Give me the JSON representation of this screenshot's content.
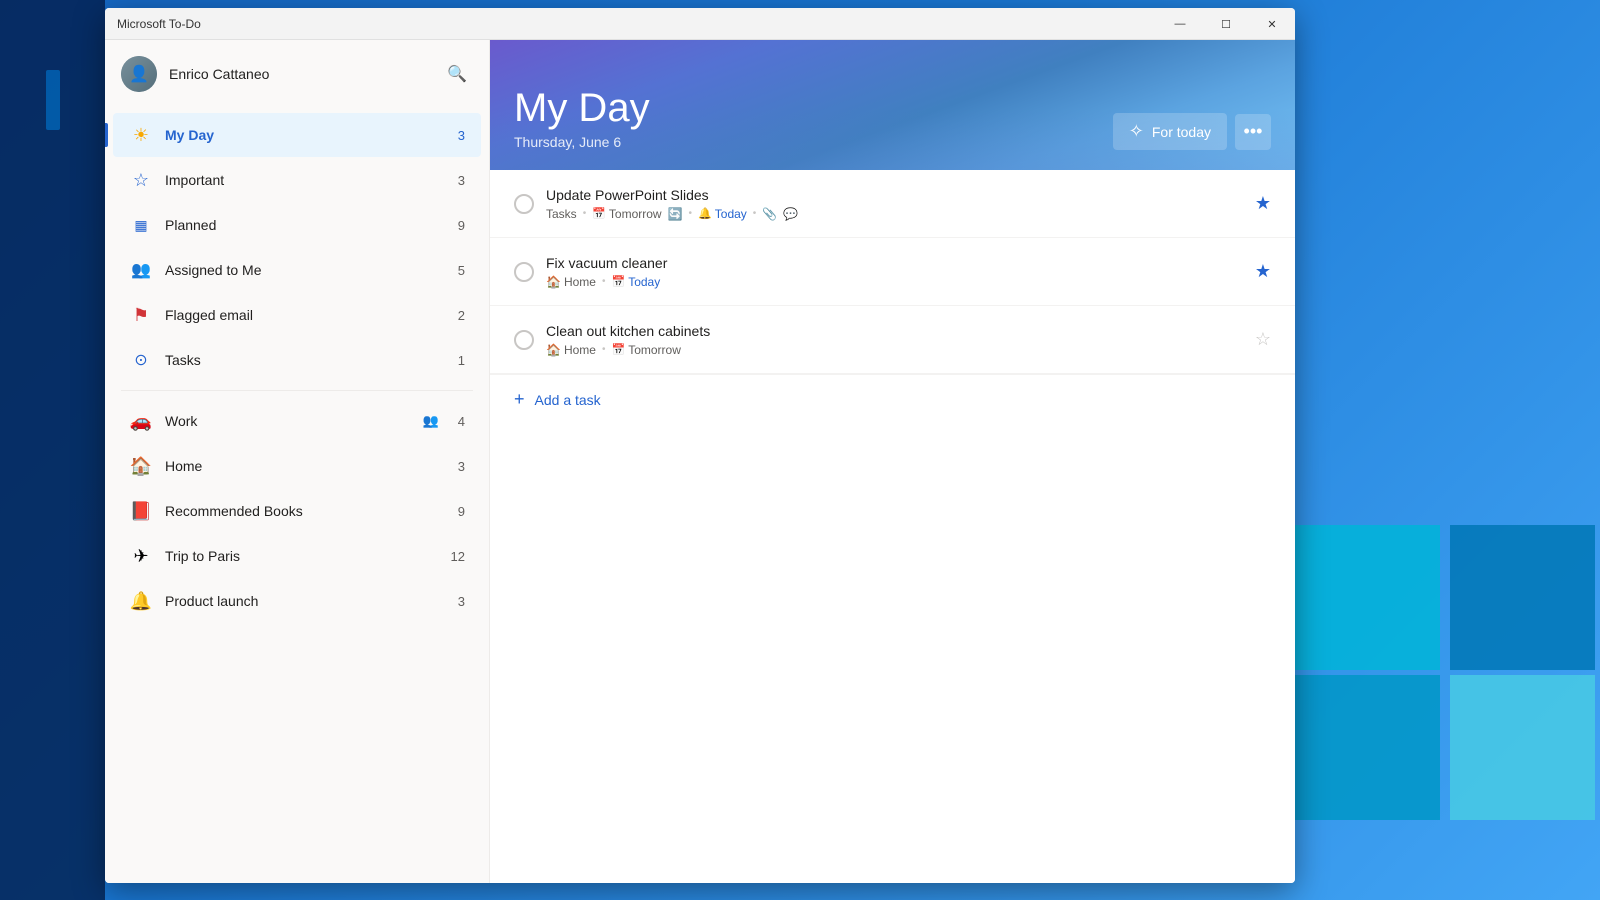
{
  "app": {
    "title": "Microsoft To-Do",
    "window_title": "Microsoft To-Do"
  },
  "titleBar": {
    "title": "Microsoft To-Do",
    "minimize": "—",
    "maximize": "☐",
    "close": "✕"
  },
  "sidebar": {
    "user": {
      "name": "Enrico Cattaneo",
      "avatar_emoji": "👤"
    },
    "search_tooltip": "Search",
    "nav_items": [
      {
        "id": "my-day",
        "label": "My Day",
        "count": "3",
        "icon": "☀",
        "active": true
      },
      {
        "id": "important",
        "label": "Important",
        "count": "3",
        "icon": "☆",
        "active": false
      },
      {
        "id": "planned",
        "label": "Planned",
        "count": "9",
        "icon": "▦",
        "active": false
      },
      {
        "id": "assigned",
        "label": "Assigned to Me",
        "count": "5",
        "icon": "👥",
        "active": false
      },
      {
        "id": "flagged",
        "label": "Flagged email",
        "count": "2",
        "icon": "⚑",
        "active": false
      },
      {
        "id": "tasks",
        "label": "Tasks",
        "count": "1",
        "icon": "⊙",
        "active": false
      }
    ],
    "list_items": [
      {
        "id": "work",
        "label": "Work",
        "count": "4",
        "icon": "🚗",
        "shared": true
      },
      {
        "id": "home",
        "label": "Home",
        "count": "3",
        "icon": "🏠",
        "shared": false
      },
      {
        "id": "books",
        "label": "Recommended Books",
        "count": "9",
        "icon": "📕",
        "shared": false
      },
      {
        "id": "paris",
        "label": "Trip to Paris",
        "count": "12",
        "icon": "✈",
        "shared": false
      },
      {
        "id": "product",
        "label": "Product launch",
        "count": "3",
        "icon": "🔔",
        "shared": false
      }
    ]
  },
  "main": {
    "header": {
      "title": "My Day",
      "subtitle": "Thursday, June 6",
      "for_today_label": "For today",
      "more_btn": "•••"
    },
    "tasks": [
      {
        "id": "task1",
        "title": "Update PowerPoint Slides",
        "list": "Tasks",
        "due": "Tomorrow",
        "reminder": "Today",
        "starred": true,
        "has_recurrence": true,
        "has_attachment": true,
        "has_note": true
      },
      {
        "id": "task2",
        "title": "Fix vacuum cleaner",
        "list": "Home",
        "due": "Today",
        "starred": true,
        "due_highlight": true
      },
      {
        "id": "task3",
        "title": "Clean out kitchen cabinets",
        "list": "Home",
        "due": "Tomorrow",
        "starred": false
      }
    ],
    "add_task_label": "Add a task"
  }
}
